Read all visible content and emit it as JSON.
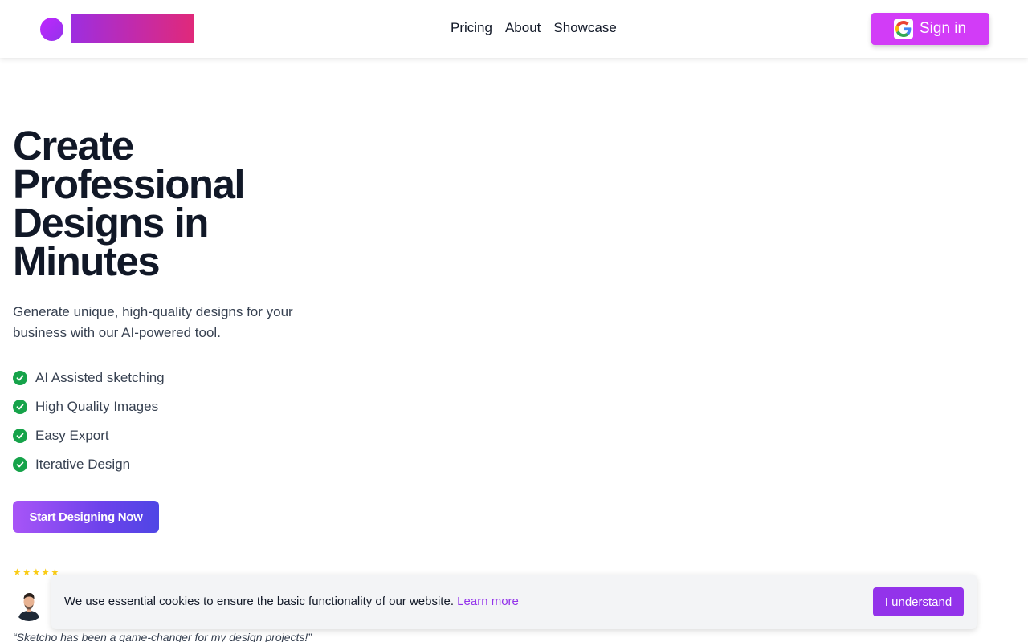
{
  "header": {
    "nav": [
      {
        "label": "Pricing"
      },
      {
        "label": "About"
      },
      {
        "label": "Showcase"
      }
    ],
    "signin_label": "Sign in",
    "signin_icon": "google-icon"
  },
  "hero": {
    "title": "Create Professional Designs in Minutes",
    "subtitle": "Generate unique, high-quality designs for your business with our AI-powered tool.",
    "features": [
      {
        "label": "AI Assisted sketching",
        "icon": "check-circle-icon"
      },
      {
        "label": "High Quality Images",
        "icon": "check-circle-icon"
      },
      {
        "label": "Easy Export",
        "icon": "check-circle-icon"
      },
      {
        "label": "Iterative Design",
        "icon": "check-circle-icon"
      }
    ],
    "cta_label": "Start Designing Now"
  },
  "testimonial": {
    "rating": 5,
    "stars": "★★★★★",
    "quote": "“Sketcho has been a game-changer for my design projects!”"
  },
  "cookie_banner": {
    "text": "We use essential cookies to ensure the basic functionality of our website.",
    "link_label": "Learn more",
    "accept_label": "I understand"
  },
  "colors": {
    "brand_purple": "#d23cf7",
    "cookie_button": "#9333ea",
    "check_green": "#16a34a",
    "star_yellow": "#facc15"
  }
}
